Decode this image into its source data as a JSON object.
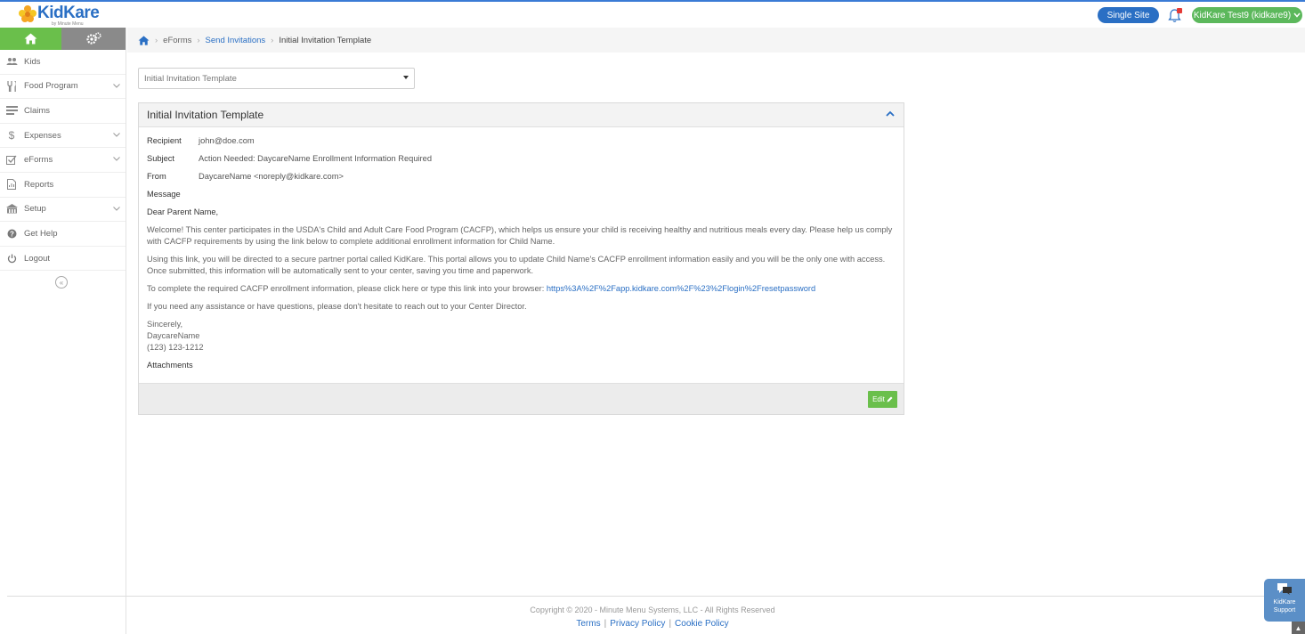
{
  "header": {
    "logo_text": "KidKare",
    "logo_sub": "by Minute Menu",
    "site_button": "Single Site",
    "user_label": "KidKare Test9 (kidkare9)"
  },
  "sidebar": {
    "items": [
      {
        "label": "Kids",
        "icon": "users-icon",
        "has_chevron": false
      },
      {
        "label": "Food Program",
        "icon": "utensils-icon",
        "has_chevron": true
      },
      {
        "label": "Claims",
        "icon": "list-icon",
        "has_chevron": false
      },
      {
        "label": "Expenses",
        "icon": "dollar-icon",
        "has_chevron": true
      },
      {
        "label": "eForms",
        "icon": "checkbox-icon",
        "has_chevron": true
      },
      {
        "label": "Reports",
        "icon": "report-icon",
        "has_chevron": false
      },
      {
        "label": "Setup",
        "icon": "building-icon",
        "has_chevron": true
      },
      {
        "label": "Get Help",
        "icon": "help-icon",
        "has_chevron": false
      },
      {
        "label": "Logout",
        "icon": "power-icon",
        "has_chevron": false
      }
    ]
  },
  "breadcrumb": {
    "items": [
      "eForms",
      "Send Invitations",
      "Initial Invitation Template"
    ]
  },
  "template_select": {
    "value": "Initial Invitation Template"
  },
  "panel": {
    "title": "Initial Invitation Template",
    "recipient_label": "Recipient",
    "recipient": "john@doe.com",
    "subject_label": "Subject",
    "subject": "Action Needed: DaycareName Enrollment Information Required",
    "from_label": "From",
    "from": "DaycareName <noreply@kidkare.com>",
    "message_label": "Message",
    "greeting": "Dear Parent Name,",
    "para1": "Welcome! This center participates in the USDA's Child and Adult Care Food Program (CACFP), which helps us ensure your child is receiving healthy and nutritious meals every day. Please help us comply with CACFP requirements by using the link below to complete additional enrollment information for Child Name.",
    "para2": "Using this link, you will be directed to a secure partner portal called KidKare. This portal allows you to update Child Name's CACFP enrollment information easily and you will be the only one with access. Once submitted, this information will be automatically sent to your center, saving you time and paperwork.",
    "para3_prefix": "To complete the required CACFP enrollment information, please click ",
    "para3_link": "here",
    "para3_mid": " or type this link into your browser: ",
    "para3_url": "https%3A%2F%2Fapp.kidkare.com%2F%23%2Flogin%2Fresetpassword",
    "para4": "If you need any assistance or have questions, please don't hesitate to reach out to your Center Director.",
    "signoff": "Sincerely,",
    "sig_name": "DaycareName",
    "sig_phone": "(123) 123-1212",
    "attachments_label": "Attachments",
    "edit_label": "Edit"
  },
  "footer": {
    "copyright": "Copyright © 2020 - Minute Menu Systems, LLC - All Rights Reserved",
    "terms": "Terms",
    "privacy": "Privacy Policy",
    "cookie": "Cookie Policy",
    "separator": "|"
  },
  "support": {
    "line1": "KidKare",
    "line2": "Support"
  },
  "colors": {
    "brand_blue": "#2a6fc4",
    "brand_green": "#6abf4b",
    "user_green": "#5cb85c"
  }
}
